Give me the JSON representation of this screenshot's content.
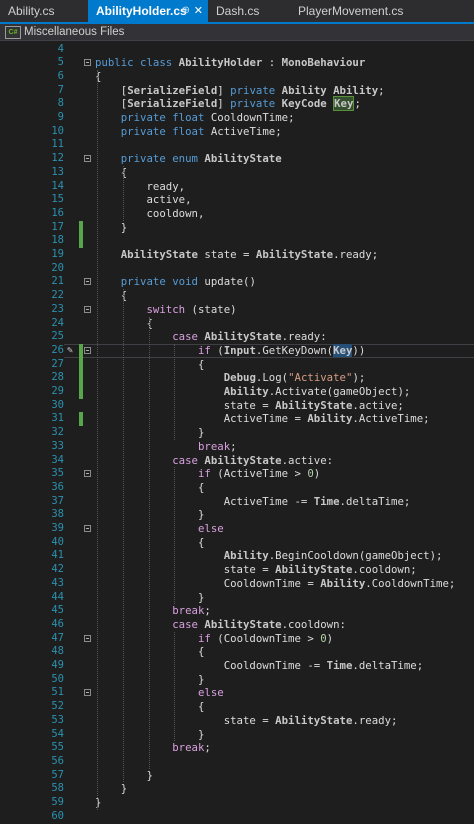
{
  "tabs": [
    {
      "label": "Ability.cs",
      "active": false
    },
    {
      "label": "AbilityHolder.cs",
      "active": true,
      "pin": "⊕",
      "close": "✕"
    },
    {
      "label": "Dash.cs",
      "active": false
    },
    {
      "label": "PlayerMovement.cs",
      "active": false
    }
  ],
  "navbar": {
    "icon": "csharp-file-icon",
    "icon_text": "C#",
    "label": "Miscellaneous Files"
  },
  "colors": {
    "accent": "#007acc",
    "keyword": "#569cd6",
    "line_number": "#2b91af",
    "change_marker": "#57a64a",
    "string": "#d69d85"
  },
  "code_lines": [
    {
      "n": "4",
      "text": ""
    },
    {
      "n": "5",
      "text": "public class AbilityHolder : MonoBehaviour"
    },
    {
      "n": "6",
      "text": "{"
    },
    {
      "n": "7",
      "text": "    [SerializeField] private Ability Ability;"
    },
    {
      "n": "8",
      "text": "    [SerializeField] private KeyCode Key;"
    },
    {
      "n": "9",
      "text": "    private float CooldownTime;"
    },
    {
      "n": "10",
      "text": "    private float ActiveTime;"
    },
    {
      "n": "11",
      "text": ""
    },
    {
      "n": "12",
      "text": "    private enum AbilityState"
    },
    {
      "n": "13",
      "text": "    {"
    },
    {
      "n": "14",
      "text": "        ready,"
    },
    {
      "n": "15",
      "text": "        active,"
    },
    {
      "n": "16",
      "text": "        cooldown,"
    },
    {
      "n": "17",
      "text": "    }"
    },
    {
      "n": "18",
      "text": ""
    },
    {
      "n": "19",
      "text": "    AbilityState state = AbilityState.ready;"
    },
    {
      "n": "20",
      "text": ""
    },
    {
      "n": "21",
      "text": "    private void update()"
    },
    {
      "n": "22",
      "text": "    {"
    },
    {
      "n": "23",
      "text": "        switch (state)"
    },
    {
      "n": "24",
      "text": "        {"
    },
    {
      "n": "25",
      "text": "            case AbilityState.ready:"
    },
    {
      "n": "26",
      "text": "                if (Input.GetKeyDown(Key))"
    },
    {
      "n": "27",
      "text": "                {"
    },
    {
      "n": "28",
      "text": "                    Debug.Log(\"Activate\");"
    },
    {
      "n": "29",
      "text": "                    Ability.Activate(gameObject);"
    },
    {
      "n": "30",
      "text": "                    state = AbilityState.active;"
    },
    {
      "n": "31",
      "text": "                    ActiveTime = Ability.ActiveTime;"
    },
    {
      "n": "32",
      "text": "                }"
    },
    {
      "n": "33",
      "text": "                break;"
    },
    {
      "n": "34",
      "text": "            case AbilityState.active:"
    },
    {
      "n": "35",
      "text": "                if (ActiveTime > 0)"
    },
    {
      "n": "36",
      "text": "                {"
    },
    {
      "n": "37",
      "text": "                    ActiveTime -= Time.deltaTime;"
    },
    {
      "n": "38",
      "text": "                }"
    },
    {
      "n": "39",
      "text": "                else"
    },
    {
      "n": "40",
      "text": "                {"
    },
    {
      "n": "41",
      "text": "                    Ability.BeginCooldown(gameObject);"
    },
    {
      "n": "42",
      "text": "                    state = AbilityState.cooldown;"
    },
    {
      "n": "43",
      "text": "                    CooldownTime = Ability.CooldownTime;"
    },
    {
      "n": "44",
      "text": "                }"
    },
    {
      "n": "45",
      "text": "            break;"
    },
    {
      "n": "46",
      "text": "            case AbilityState.cooldown:"
    },
    {
      "n": "47",
      "text": "                if (CooldownTime > 0)"
    },
    {
      "n": "48",
      "text": "                {"
    },
    {
      "n": "49",
      "text": "                    CooldownTime -= Time.deltaTime;"
    },
    {
      "n": "50",
      "text": "                }"
    },
    {
      "n": "51",
      "text": "                else"
    },
    {
      "n": "52",
      "text": "                {"
    },
    {
      "n": "53",
      "text": "                    state = AbilityState.ready;"
    },
    {
      "n": "54",
      "text": "                }"
    },
    {
      "n": "55",
      "text": "            break;"
    },
    {
      "n": "56",
      "text": ""
    },
    {
      "n": "57",
      "text": "        }"
    },
    {
      "n": "58",
      "text": "    }"
    },
    {
      "n": "59",
      "text": "}"
    },
    {
      "n": "60",
      "text": ""
    }
  ],
  "fold_lines": [
    "5",
    "12",
    "21",
    "23",
    "26",
    "35",
    "39",
    "47",
    "51"
  ],
  "changed_lines": [
    "17",
    "18",
    "26",
    "27",
    "28",
    "29",
    "31"
  ],
  "current_line": "26"
}
